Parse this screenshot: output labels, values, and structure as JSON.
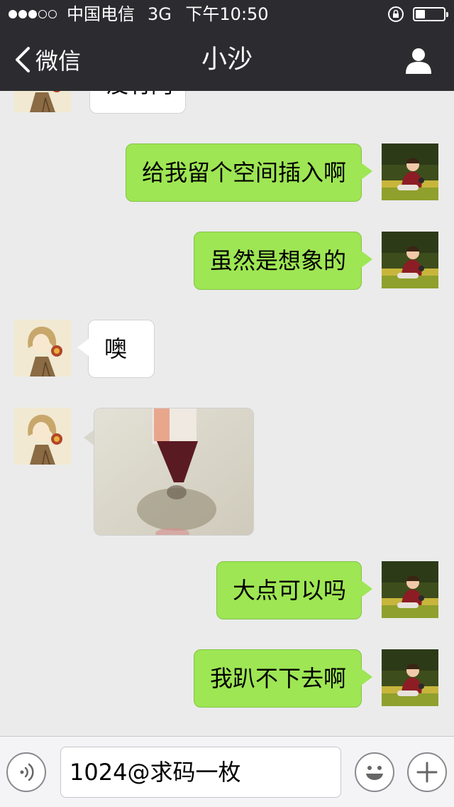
{
  "status": {
    "carrier": "中国电信",
    "network": "3G",
    "time": "下午10:50",
    "signal_full": 3,
    "signal_empty": 2,
    "battery_level": 0.35
  },
  "nav": {
    "back_label": "微信",
    "title": "小沙"
  },
  "colors": {
    "header_bg": "#2c2c30",
    "chat_bg": "#ebebeb",
    "outgoing_bubble": "#9ee654",
    "incoming_bubble": "#ffffff"
  },
  "messages": [
    {
      "direction": "in",
      "type": "text",
      "text": "没有阿"
    },
    {
      "direction": "out",
      "type": "text",
      "text": "给我留个空间插入啊"
    },
    {
      "direction": "out",
      "type": "text",
      "text": "虽然是想象的"
    },
    {
      "direction": "in",
      "type": "text",
      "text": "噢"
    },
    {
      "direction": "in",
      "type": "image",
      "icon": "photo-thumbnail"
    },
    {
      "direction": "out",
      "type": "text",
      "text": "大点可以吗"
    },
    {
      "direction": "out",
      "type": "text",
      "text": "我趴不下去啊"
    }
  ],
  "input": {
    "value": "1024@求码一枚",
    "icons": [
      "voice-icon",
      "emoji-icon",
      "plus-icon"
    ]
  }
}
